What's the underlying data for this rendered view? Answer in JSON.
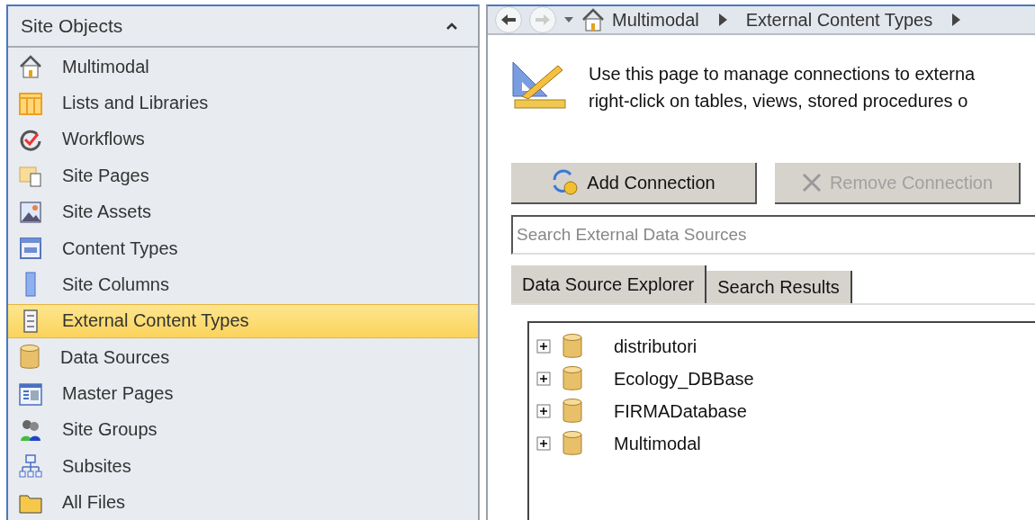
{
  "sidebar": {
    "title": "Site Objects",
    "expanded": true,
    "items": [
      {
        "label": "Multimodal",
        "kind": "home",
        "selected": false
      },
      {
        "label": "Lists and Libraries",
        "kind": "lists",
        "selected": false
      },
      {
        "label": "Workflows",
        "kind": "workflow",
        "selected": false
      },
      {
        "label": "Site Pages",
        "kind": "pages",
        "selected": false
      },
      {
        "label": "Site Assets",
        "kind": "assets",
        "selected": false
      },
      {
        "label": "Content Types",
        "kind": "ctypes",
        "selected": false
      },
      {
        "label": "Site Columns",
        "kind": "columns",
        "selected": false
      },
      {
        "label": "External Content Types",
        "kind": "ext",
        "selected": true
      },
      {
        "label": "Data Sources",
        "kind": "db",
        "selected": false
      },
      {
        "label": "Master Pages",
        "kind": "master",
        "selected": false
      },
      {
        "label": "Site Groups",
        "kind": "groups",
        "selected": false
      },
      {
        "label": "Subsites",
        "kind": "subsites",
        "selected": false
      },
      {
        "label": "All Files",
        "kind": "folder",
        "selected": false
      }
    ]
  },
  "breadcrumb": {
    "back_disabled": false,
    "forward_disabled": true,
    "items": [
      "Multimodal",
      "External Content Types"
    ]
  },
  "description": [
    "Use this page to manage connections to externa",
    "right-click on tables, views, stored procedures o"
  ],
  "buttons": [
    {
      "label": "Add Connection",
      "kind": "add",
      "disabled": false
    },
    {
      "label": "Remove Connection",
      "kind": "remove",
      "disabled": true
    }
  ],
  "search": {
    "placeholder": "Search External Data Sources"
  },
  "tabs": [
    {
      "label": "Data Source Explorer",
      "selected": true
    },
    {
      "label": "Search Results",
      "selected": false
    }
  ],
  "tree": [
    {
      "label": "distributori",
      "expanded": false
    },
    {
      "label": "Ecology_DBBase",
      "expanded": false
    },
    {
      "label": "FIRMADatabase",
      "expanded": false
    },
    {
      "label": "Multimodal",
      "expanded": false
    }
  ]
}
